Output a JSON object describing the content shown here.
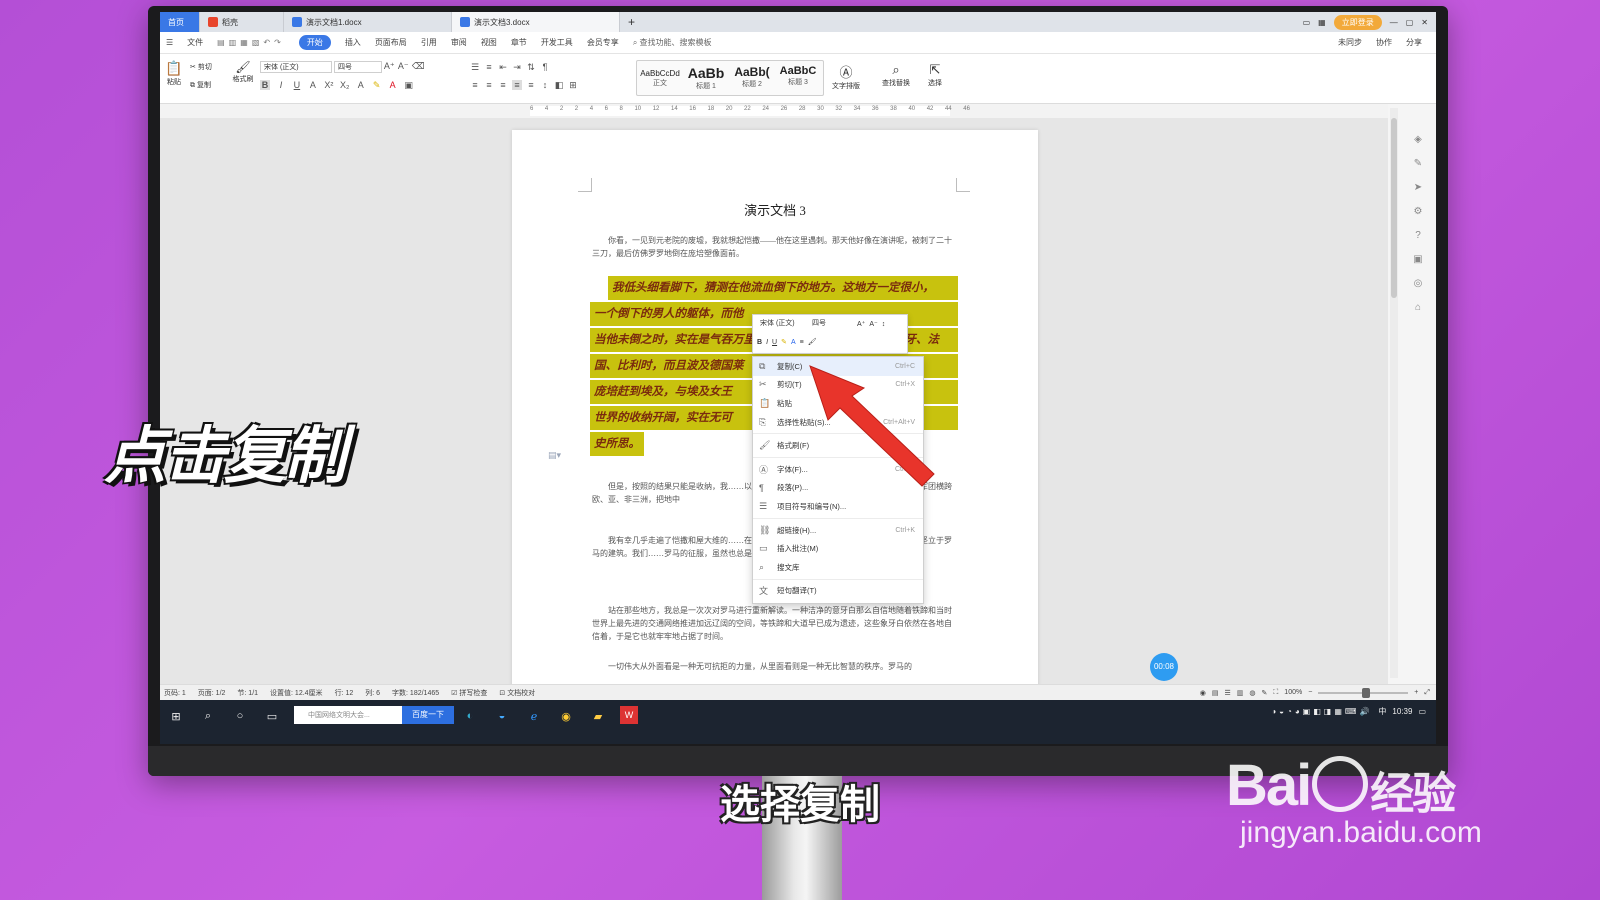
{
  "tabs": [
    {
      "label": "首页"
    },
    {
      "label": "稻壳"
    },
    {
      "label": "演示文档1.docx"
    },
    {
      "label": "演示文档3.docx"
    }
  ],
  "title_right": {
    "login": "立即登录"
  },
  "menubar": {
    "items": [
      "文件",
      "开始",
      "插入",
      "页面布局",
      "引用",
      "审阅",
      "视图",
      "章节",
      "开发工具",
      "会员专享"
    ],
    "active": "开始",
    "search": "查找功能、搜索模板",
    "right": [
      "未同步",
      "协作",
      "分享"
    ]
  },
  "ribbon": {
    "paste": "粘贴",
    "cut": "剪切",
    "copy": "复制",
    "format_painter": "格式刷",
    "font_name": "宋体 (正文)",
    "font_size": "四号",
    "styles": [
      {
        "preview": "AaBbCcDd",
        "label": "正文"
      },
      {
        "preview": "AaBb",
        "label": "标题 1"
      },
      {
        "preview": "AaBb(",
        "label": "标题 2"
      },
      {
        "preview": "AaBbC",
        "label": "标题 3"
      }
    ],
    "text_layout": "文字排版",
    "find_replace": "查找替换",
    "select": "选择"
  },
  "ruler": [
    "6",
    "4",
    "2",
    "2",
    "4",
    "6",
    "8",
    "10",
    "12",
    "14",
    "16",
    "18",
    "20",
    "22",
    "24",
    "26",
    "28",
    "30",
    "32",
    "34",
    "36",
    "38",
    "40",
    "42",
    "44",
    "46"
  ],
  "document": {
    "title": "演示文档 3",
    "para1": "你看，一见到元老院的废墟，我就想起恺撒——他在这里遇刺。那天他好像在演讲呢，被刺了二十三刀，最后仿佛罗罗地倒在庞培塑像面前。",
    "highlight_lines": [
      "我低头细看脚下，猜测在他流血倒下的地方。这地方一定很小，",
      "一个倒下的男人的躯体，而他",
      "当他未倒之时，实在是气吞万里，不仅统治现在意大利、西班牙、法",
      "国、比利时，而且波及德国莱",
      "庞培赶到埃及，与埃及女王",
      "世界的收纳开阔，实在无可",
      "史所思。"
    ],
    "para2": "但是，按照的结果只能是收纳，我……以死亡完成最后的收纳和服从之后，他……罗马的军团横跨欧、亚、非三洲，把地中",
    "para3": "我有幸几乎走遍了恺撒和屋大维的……在那里，经常可以看到早已残损的古罗……今天还坚立于罗马的建筑。我们……罗马的征服，虽然也总是以残酷为先导，",
    "para4": "站在那些地方，我总是一次次对罗马进行重新解读。一种洁净的意牙白那么自信地随着铁蹄和当时世界上最先进的交通网络推进加远辽阔的空间，等铁蹄和大道早已成为遗迹，这些象牙白依然在各地自信着，于是它也就牢牢地占据了时间。",
    "para5": "一切伟大从外面看是一种无可抗拒的力量，从里面看则是一种无比智慧的秩序。罗马的"
  },
  "minibar": {
    "font": "宋体 (正文)",
    "size": "四号"
  },
  "context_menu": [
    {
      "icon": "copy-icon",
      "label": "复制(C)",
      "shortcut": "Ctrl+C",
      "hover": true
    },
    {
      "icon": "scissors-icon",
      "label": "剪切(T)",
      "shortcut": "Ctrl+X"
    },
    {
      "icon": "paste-icon",
      "label": "粘贴",
      "shortcut": ""
    },
    {
      "icon": "paste-special-icon",
      "label": "选择性粘贴(S)...",
      "shortcut": "Ctrl+Alt+V"
    },
    {
      "sep": true
    },
    {
      "icon": "format-painter-icon",
      "label": "格式刷(F)",
      "shortcut": ""
    },
    {
      "sep": true
    },
    {
      "icon": "font-icon",
      "label": "字体(F)...",
      "shortcut": "Ctrl+D"
    },
    {
      "icon": "paragraph-icon",
      "label": "段落(P)...",
      "shortcut": ""
    },
    {
      "icon": "list-icon",
      "label": "项目符号和编号(N)...",
      "shortcut": ""
    },
    {
      "sep": true
    },
    {
      "icon": "link-icon",
      "label": "超链接(H)...",
      "shortcut": "Ctrl+K"
    },
    {
      "icon": "comment-icon",
      "label": "插入批注(M)",
      "shortcut": ""
    },
    {
      "icon": "search-icon",
      "label": "搜文库",
      "shortcut": ""
    },
    {
      "sep": true
    },
    {
      "icon": "translate-icon",
      "label": "短句翻译(T)",
      "shortcut": ""
    }
  ],
  "timer": "00:08",
  "statusbar": {
    "page": "页码: 1",
    "pages": "页面: 1/2",
    "section": "节: 1/1",
    "position": "设置值: 12.4厘米",
    "row": "行: 12",
    "col": "列: 6",
    "words": "字数: 182/1465",
    "spell": "拼写检查",
    "proof": "文档校对",
    "zoom": "100%"
  },
  "taskbar": {
    "search_placeholder": "中国网络文明大会...",
    "search_button": "百度一下",
    "clock": "10:39",
    "ime": "中"
  },
  "overlay": {
    "left_caption": "点击复制",
    "subtitle": "选择复制",
    "watermark_brand": "Bai",
    "watermark_brand2": "经验",
    "watermark_url": "jingyan.baidu.com"
  }
}
